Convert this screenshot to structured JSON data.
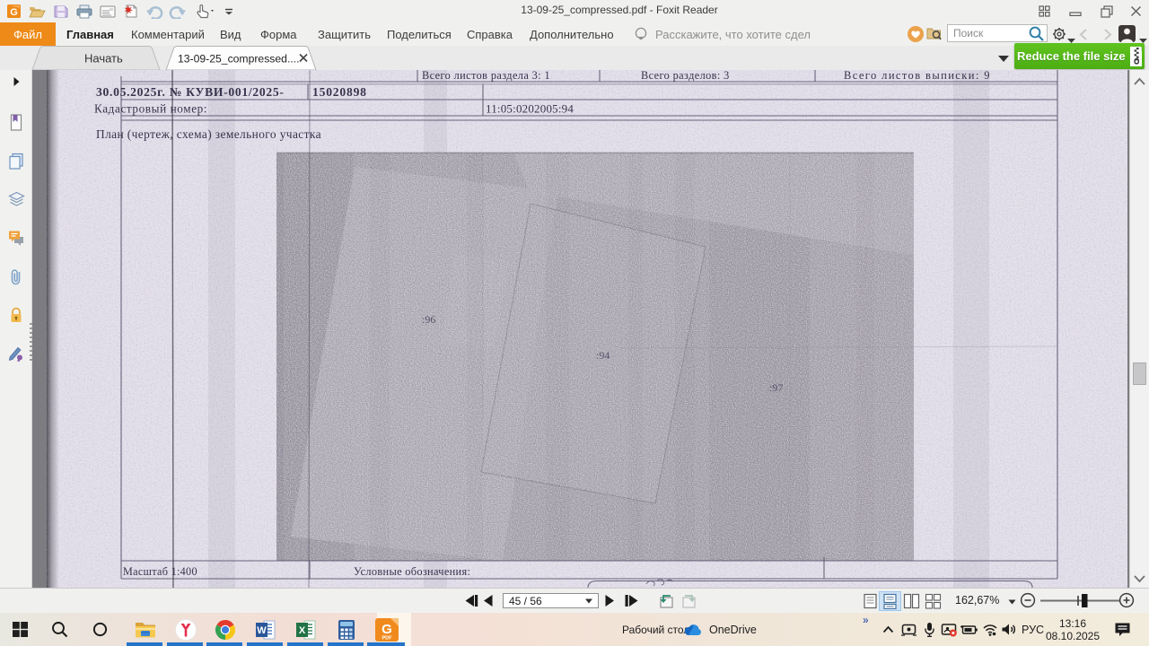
{
  "window": {
    "title": "13-09-25_compressed.pdf - Foxit Reader",
    "quick_access_icons": [
      "foxit-logo",
      "open-file",
      "save",
      "print",
      "email",
      "create-pdf",
      "undo",
      "redo",
      "hand-tool",
      "customize-quick-access"
    ],
    "window_control_icons": [
      "layout-grid",
      "minimize",
      "restore",
      "close"
    ]
  },
  "menubar": {
    "file_label": "Файл",
    "items": [
      {
        "label": "Главная",
        "active": true
      },
      {
        "label": "Комментарий",
        "active": false
      },
      {
        "label": "Вид",
        "active": false
      },
      {
        "label": "Форма",
        "active": false
      },
      {
        "label": "Защитить",
        "active": false
      },
      {
        "label": "Поделиться",
        "active": false
      },
      {
        "label": "Справка",
        "active": false
      },
      {
        "label": "Дополнительно",
        "active": false
      }
    ],
    "assistant_hint": "Расскажите, что хотите сдел",
    "search_placeholder": "Поиск",
    "right_icons": [
      "favorite-heart",
      "search-in-folder",
      "search-magnifier",
      "gear",
      "back-chevron",
      "forward-chevron",
      "user-avatar"
    ]
  },
  "tabbar": {
    "start_tab": "Начать",
    "document_tab": "13-09-25_compressed....",
    "close_glyph": "✕",
    "reduce_button_label": "Reduce the file size",
    "reduce_button_color": "#4fb317"
  },
  "sidebar": {
    "icons": [
      "expand-panel-arrow",
      "bookmarks",
      "page-thumbnails",
      "layers",
      "comments",
      "attachments",
      "security",
      "digital-signatures"
    ]
  },
  "document": {
    "header_cell_1": "Всего листов раздела 3: 1",
    "header_cell_2": "Всего разделов: 3",
    "header_cell_3": "Всего листов выписки: 9",
    "request_line": "30.05.2025г.  № КУВИ-001/2025-",
    "request_number": "15020898",
    "cadastral_label": "Кадастровый номер:",
    "cadastral_value": "11:05:0202005:94",
    "plan_title": "План (чертеж, схема) земельного участка",
    "plot_label_left": ":96",
    "plot_label_center": ":94",
    "plot_label_right": ":97",
    "scale_label": "Масштаб 1:400",
    "legend_label": "Условные обозначения:"
  },
  "statusbar": {
    "page_display": "45 / 56",
    "zoom_display": "162,67%",
    "nav_icons": [
      "first-page",
      "previous-page",
      "next-page",
      "last-page",
      "previous-view",
      "next-view"
    ],
    "layout_icons": [
      "single-page",
      "continuous",
      "facing",
      "continuous-facing"
    ],
    "active_layout": "continuous"
  },
  "taskbar": {
    "desktop_label": "Рабочий стол",
    "onedrive_label": "OneDrive",
    "overflow_glyph": "»",
    "language": "РУС",
    "time": "13:16",
    "date": "08.10.2025",
    "left_icons": [
      "windows-start",
      "search",
      "cortana"
    ],
    "app_icons": [
      "file-explorer",
      "yandex-browser",
      "chrome",
      "word",
      "excel",
      "calculator",
      "foxit-reader"
    ],
    "tray_icons": [
      "display-connect",
      "microphone",
      "screen-record",
      "battery",
      "wifi",
      "volume",
      "action-center"
    ]
  }
}
